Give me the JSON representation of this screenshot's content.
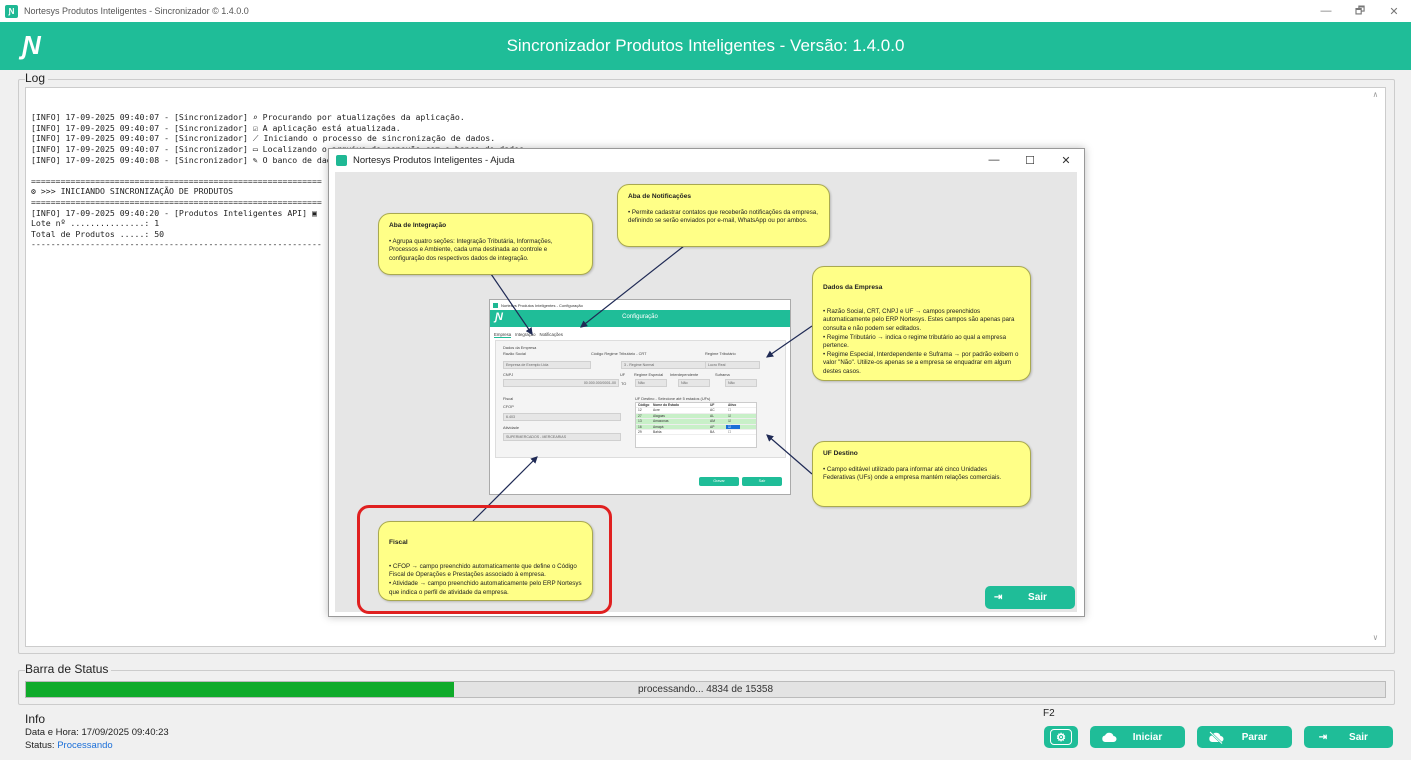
{
  "window": {
    "title": "Nortesys Produtos Inteligentes - Sincronizador © 1.4.0.0",
    "app_icon": "nortesys-app-icon",
    "controls": [
      "—",
      "🗗",
      "✕"
    ]
  },
  "header": {
    "logo": "Ɲ",
    "title": "Sincronizador Produtos Inteligentes - Versão: 1.4.0.0",
    "color": "#1fbd98"
  },
  "log": {
    "label": "Log",
    "lines": [
      "[INFO] 17-09-2025 09:40:07 - [Sincronizador] ⌕ Procurando por atualizações da aplicação.",
      "[INFO] 17-09-2025 09:40:07 - [Sincronizador] ☑ A aplicação está atualizada.",
      "[INFO] 17-09-2025 09:40:07 - [Sincronizador] ⟋ Iniciando o processo de sincronização de dados.",
      "[INFO] 17-09-2025 09:40:07 - [Sincronizador] ▭ Localizando o arquivo de conexão com o banco de dados.",
      "[INFO] 17-09-2025 09:40:08 - [Sincronizador] ✎ O banco de dados \"CASANOVA\" foi localizado no Servidor \"192.168.0.150\\CLINIC\".",
      "",
      "===========================================================",
      "⚙ >>> INICIANDO SINCRONIZAÇÃO DE PRODUTOS",
      "===========================================================",
      "[INFO] 17-09-2025 09:40:20 - [Produtos Inteligentes API] ▣",
      "Lote nº ...............: 1",
      "Total de Produtos .....: 50",
      "-----------------------------------------------------------"
    ]
  },
  "status_bar": {
    "label": "Barra de Status",
    "text": "processando... 4834 de 15358",
    "progress_fraction": 0.3148,
    "color": "#0fab2a"
  },
  "info": {
    "label": "Info",
    "datetime_label": "Data e Hora:",
    "datetime_value": "17/09/2025 09:40:23",
    "status_label": "Status:",
    "status_value": "Processando",
    "status_color": "#1b6fd8"
  },
  "toolbar": {
    "shortcut_label": "F2",
    "settings_icon": "gear-icon",
    "iniciar": "Iniciar",
    "parar": "Parar",
    "sair": "Sair"
  },
  "help_dialog": {
    "title": "Nortesys Produtos Inteligentes - Ajuda",
    "controls": [
      "—",
      "☐",
      "✕"
    ],
    "sair": "Sair",
    "notes": {
      "notificacoes": {
        "title": "Aba de Notificações",
        "text": "• Permite cadastrar contatos que receberão notificações da empresa, definindo se serão enviados por e-mail, WhatsApp ou por ambos."
      },
      "integracao": {
        "title": "Aba de Integração",
        "text": "• Agrupa quatro seções: Integração Tributária, Informações, Processos e Ambiente, cada uma destinada ao controle e configuração dos respectivos dados de integração."
      },
      "empresa": {
        "title": "Dados da Empresa",
        "text": "• Razão Social, CRT, CNPJ e UF → campos preenchidos automaticamente pelo ERP Nortesys. Estes campos são apenas para consulta e não podem ser editados.\n• Regime Tributário → indica o regime tributário ao qual a empresa pertence.\n• Regime Especial, Interdependente e Suframa → por padrão exibem o valor \"Não\". Utilize-os apenas se a empresa se enquadrar em algum destes casos."
      },
      "uf": {
        "title": "UF Destino",
        "text": "• Campo editável utilizado para informar até cinco Unidades Federativas (UFs) onde a empresa mantém relações comerciais."
      },
      "fiscal": {
        "title": "Fiscal",
        "text": "• CFOP → campo preenchido automaticamente que define o Código Fiscal de Operações e Prestações associado à empresa.\n• Atividade → campo preenchido automaticamente pelo ERP Nortesys que indica o perfil de atividade da empresa."
      }
    },
    "config_preview": {
      "title": "Nortesys Produtos Inteligentes - Configuração",
      "header": "Configuração",
      "tabs": [
        "Empresa",
        "Integração",
        "Notificações"
      ],
      "section": "Dados da Empresa",
      "razao_label": "Razão Social",
      "razao_value": "Empresa de Exemplo Ltda",
      "crt_label": "Código Regime Tributário - CRT",
      "crt_value": "3 - Regime Normal",
      "regime_label": "Regime Tributário",
      "regime_value": "Lucro Real",
      "cnpj_label": "CNPJ",
      "cnpj_value": "00.000.000/0001-00",
      "uf_label": "UF",
      "uf_value": "TO",
      "especial_label": "Regime Especial",
      "inter_label": "Interdependente",
      "suframa_label": "Suframa",
      "nao": "Não",
      "fiscal_label": "Fiscal",
      "cfop_label": "CFOP",
      "cfop_value": "6.403",
      "atividade_label": "Atividade",
      "atividade_value": "SUPERMERCADOS - MERCEARIAS",
      "uf_destino_label": "UF Destino - Selecione até 5 estados (UFs)",
      "table_headers": [
        "Código",
        "Nome do Estado",
        "UF",
        "Ativo"
      ],
      "table_rows": [
        [
          "12",
          "Acre",
          "AC",
          "☐"
        ],
        [
          "27",
          "Alagoas",
          "AL",
          "☑"
        ],
        [
          "13",
          "Amazonas",
          "AM",
          "☑"
        ],
        [
          "16",
          "Amapá",
          "AP",
          "☑"
        ],
        [
          "29",
          "Bahia",
          "BA",
          "☐"
        ]
      ],
      "gravar": "Gravar",
      "sair": "Sair"
    }
  }
}
